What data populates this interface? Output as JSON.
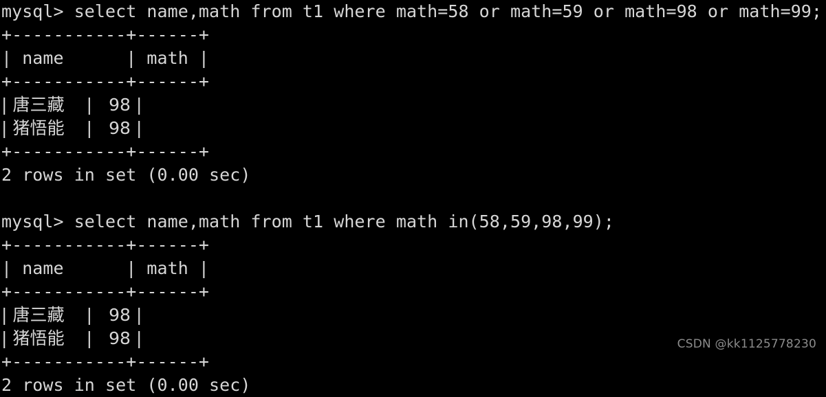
{
  "terminal": {
    "background_color": "#000000",
    "foreground_color": "#d6d6d6",
    "lines": [
      "mysql> select name,math from t1 where math=58 or math=59 or math=98 or math=99;",
      "+-----------+------+",
      "| name      | math |",
      "+-----------+------+",
      "| 唐三藏    |   98 |",
      "| 猪悟能    |   98 |",
      "+-----------+------+",
      "2 rows in set (0.00 sec)",
      "",
      "mysql> select name,math from t1 where math in(58,59,98,99);",
      "+-----------+------+",
      "| name      | math |",
      "+-----------+------+",
      "| 唐三藏    |   98 |",
      "| 猪悟能    |   98 |",
      "+-----------+------+",
      "2 rows in set (0.00 sec)"
    ],
    "blocks": [
      {
        "prompt": "mysql>",
        "command": "select name,math from t1 where math=58 or math=59 or math=98 or math=99;",
        "table": {
          "separator": "+-----------+------+",
          "headers": [
            "name",
            "math"
          ],
          "rows": [
            {
              "name": "唐三藏",
              "math": "98"
            },
            {
              "name": "猪悟能",
              "math": "98"
            }
          ]
        },
        "status": "2 rows in set (0.00 sec)"
      },
      {
        "prompt": "mysql>",
        "command": "select name,math from t1 where math in(58,59,98,99);",
        "table": {
          "separator": "+-----------+------+",
          "headers": [
            "name",
            "math"
          ],
          "rows": [
            {
              "name": "唐三藏",
              "math": "98"
            },
            {
              "name": "猪悟能",
              "math": "98"
            }
          ]
        },
        "status": "2 rows in set (0.00 sec)"
      }
    ]
  },
  "watermark": {
    "text": "CSDN @kk1125778230",
    "color": "#8c8c8c"
  }
}
